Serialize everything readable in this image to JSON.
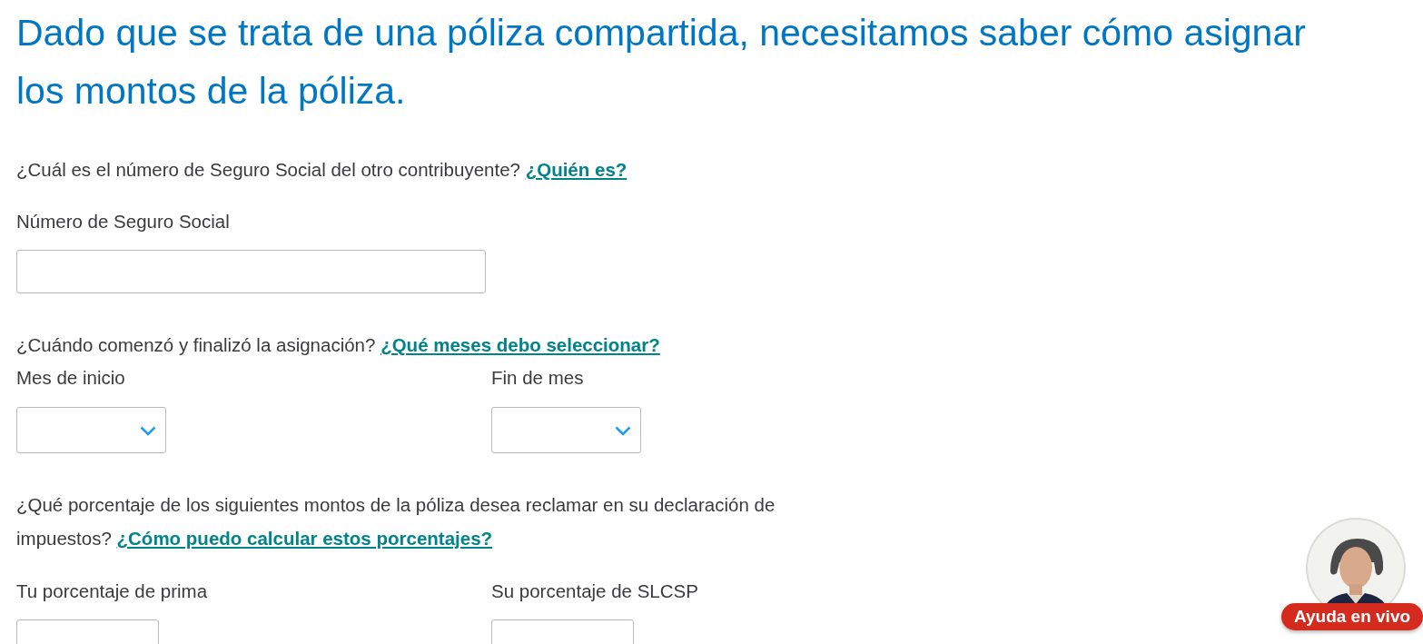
{
  "heading": "Dado que se trata de una póliza compartida, necesitamos saber cómo asignar los montos de la póliza.",
  "ssn_question": {
    "text": "¿Cuál es el número de Seguro Social del otro contribuyente?",
    "link": "¿Quién es?"
  },
  "ssn_field": {
    "label": "Número de Seguro Social"
  },
  "months_question": {
    "text": "¿Cuándo comenzó y finalizó la asignación?",
    "link": "¿Qué meses debo seleccionar?"
  },
  "month_selects": [
    {
      "label": "Mes de inicio"
    },
    {
      "label": "Fin de mes"
    }
  ],
  "percent_question": {
    "text": "¿Qué porcentaje de los siguientes montos de la póliza desea reclamar en su declaración de impuestos?",
    "link": "¿Cómo puedo calcular estos porcentajes?"
  },
  "percent_fields": [
    {
      "label": "Tu porcentaje de prima"
    },
    {
      "label": "Su porcentaje de SLCSP"
    }
  ],
  "help_button": {
    "label": "Ayuda en vivo"
  }
}
